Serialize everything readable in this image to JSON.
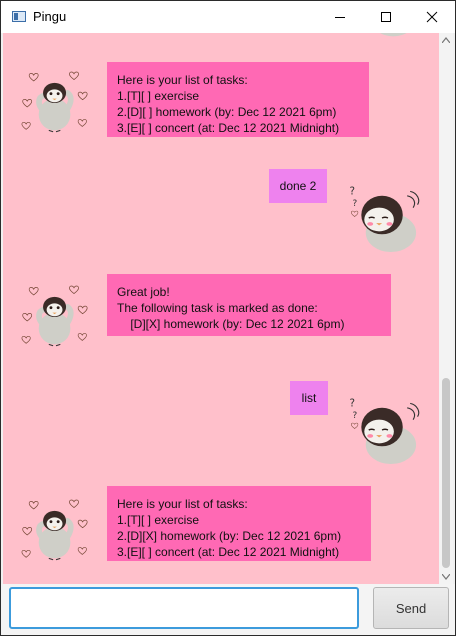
{
  "window": {
    "title": "Pingu",
    "minimize_icon": "minimize-icon",
    "maximize_icon": "maximize-icon",
    "close_icon": "close-icon"
  },
  "messages": [
    {
      "sender": "bot",
      "text": "Here is your list of tasks:\n1.[T][ ] exercise\n2.[D][ ] homework (by: Dec 12 2021 6pm)\n3.[E][ ] concert (at: Dec 12 2021 Midnight)"
    },
    {
      "sender": "user",
      "text": "done 2"
    },
    {
      "sender": "bot",
      "text": "Great job!\nThe following task is marked as done:\n\t[D][X] homework (by: Dec 12 2021 6pm)"
    },
    {
      "sender": "user",
      "text": "list"
    },
    {
      "sender": "bot",
      "text": "Here is your list of tasks:\n1.[T][ ] exercise\n2.[D][X] homework (by: Dec 12 2021 6pm)\n3.[E][ ] concert (at: Dec 12 2021 Midnight)"
    }
  ],
  "input": {
    "value": "",
    "placeholder": ""
  },
  "send_label": "Send",
  "colors": {
    "chat_background": "#ffc0cb",
    "bot_bubble": "#ff69b4",
    "user_bubble": "#ee82ee",
    "input_focus": "#3c9bdc"
  }
}
